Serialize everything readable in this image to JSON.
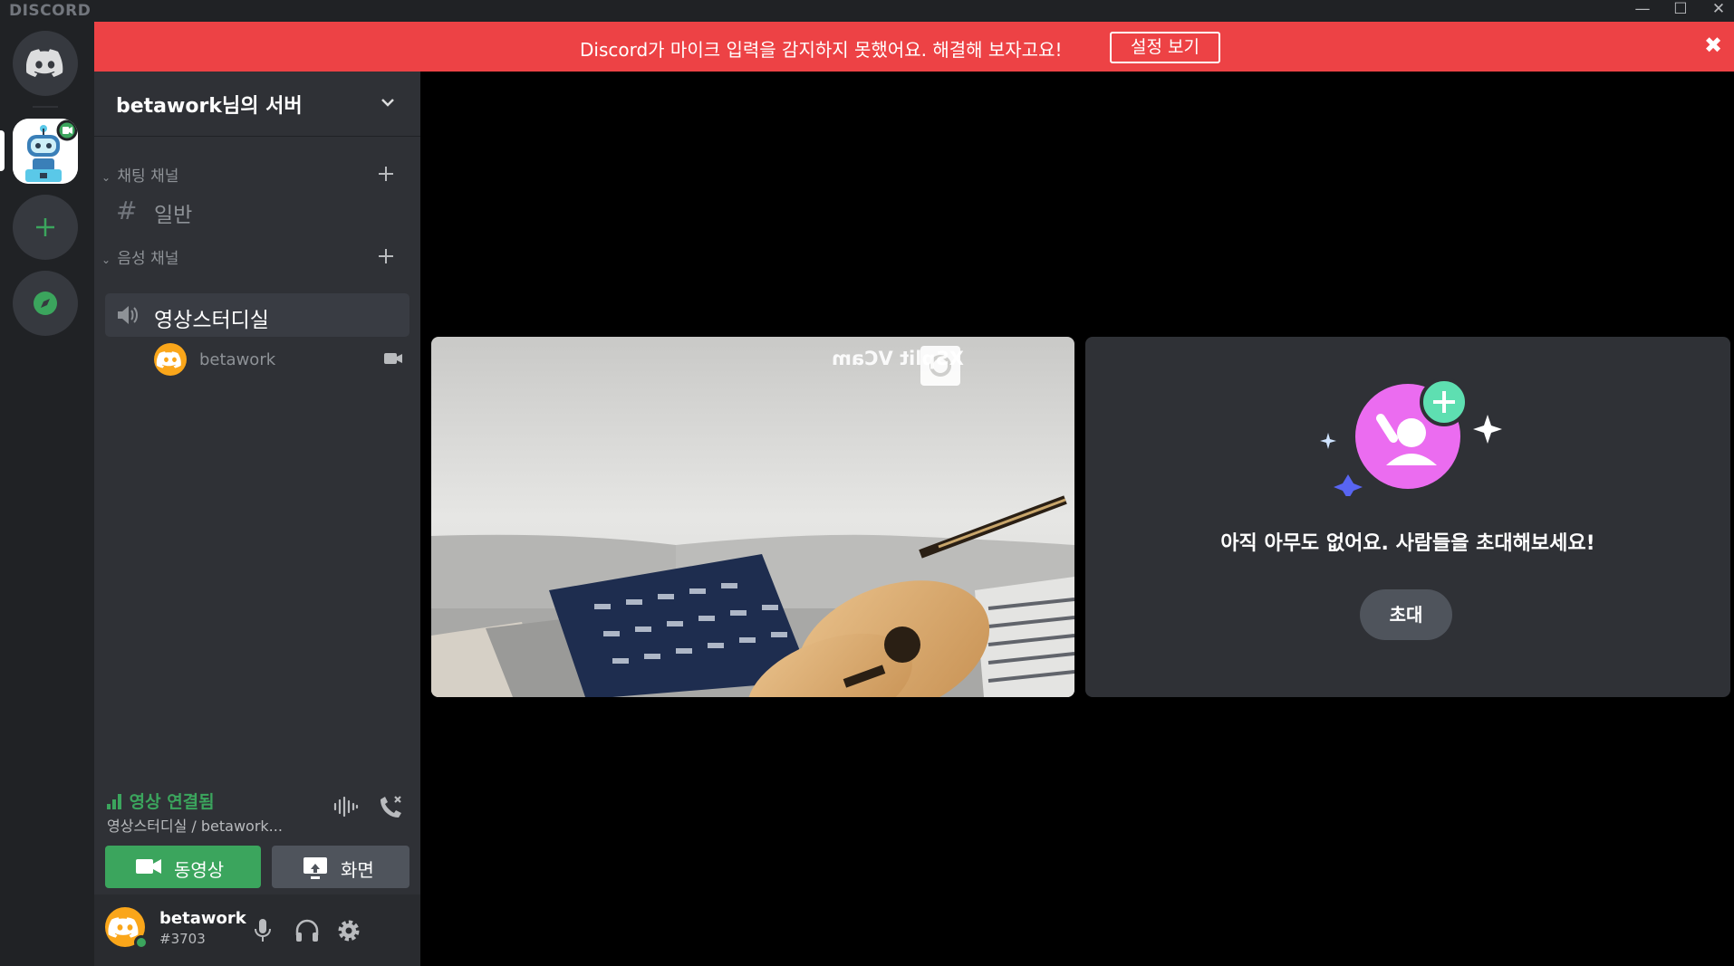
{
  "titlebar": {
    "brand": "DISCORD",
    "minimize": "—",
    "maximize": "☐",
    "close": "✕"
  },
  "notice": {
    "message": "Discord가 마이크 입력을 감지하지 못했어요. 해결해 보자고요!",
    "action_label": "설정 보기",
    "close": "✖",
    "color": "#ed4245"
  },
  "server": {
    "name": "betawork님의 서버"
  },
  "categories": [
    {
      "label": "채팅 채널",
      "channels": [
        {
          "icon": "hash-icon",
          "name": "일반"
        }
      ]
    },
    {
      "label": "음성 채널",
      "channels": [
        {
          "icon": "speaker-icon",
          "name": "영상스터디실"
        }
      ]
    }
  ],
  "voice_user": {
    "name": "betawork"
  },
  "rtc": {
    "status": "영상 연결됨",
    "channel": "영상스터디실 / betawork...",
    "video_label": "동영상",
    "screen_label": "화면",
    "status_color": "#3ba55d"
  },
  "user": {
    "name": "betawork",
    "tag": "#3703"
  },
  "stage": {
    "watermark": "XSplit VCam",
    "empty_message": "아직 아무도 없어요. 사람들을 초대해보세요!",
    "invite_label": "초대"
  }
}
